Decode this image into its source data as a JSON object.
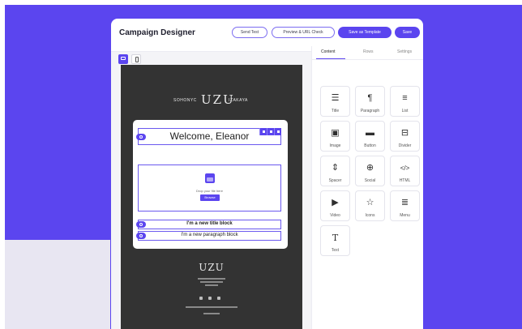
{
  "app": {
    "title": "Campaign Designer"
  },
  "header": {
    "buttons": [
      {
        "label": "Send Test"
      },
      {
        "label": "Preview & URL Check"
      },
      {
        "label": "Save as Template"
      },
      {
        "label": "Save"
      }
    ]
  },
  "device_toggle": {
    "desktop_icon": "desktop-icon",
    "mobile_icon": "mobile-icon",
    "active": "desktop"
  },
  "email": {
    "brand_left": "SOHONYC",
    "brand_logo": "UZU",
    "brand_right": "IZAKAYA",
    "welcome_text": "Welcome, Eleanor",
    "drop_text": "Drop your file here",
    "browse_label": "Browse",
    "new_title_block": "I'm a new title block",
    "new_paragraph_block": "I'm a new paragraph block",
    "footer_logo": "UZU",
    "row_tools": [
      "save-icon",
      "duplicate-icon",
      "delete-icon"
    ]
  },
  "panel": {
    "tabs": [
      {
        "label": "Content"
      },
      {
        "label": "Rows"
      },
      {
        "label": "Settings"
      }
    ],
    "active_tab": "Content",
    "tiles": [
      {
        "label": "Title",
        "icon": "☰"
      },
      {
        "label": "Paragraph",
        "icon": "¶"
      },
      {
        "label": "List",
        "icon": "≡"
      },
      {
        "label": "Image",
        "icon": "▣"
      },
      {
        "label": "Button",
        "icon": "▬"
      },
      {
        "label": "Divider",
        "icon": "⊟"
      },
      {
        "label": "Spacer",
        "icon": "⇕"
      },
      {
        "label": "Social",
        "icon": "⊕"
      },
      {
        "label": "HTML",
        "icon": "</>"
      },
      {
        "label": "Video",
        "icon": "▶"
      },
      {
        "label": "Icons",
        "icon": "☆"
      },
      {
        "label": "Menu",
        "icon": "≣"
      },
      {
        "label": "Text",
        "icon": "T"
      }
    ]
  },
  "colors": {
    "accent": "#5b45ef",
    "email_background": "#333333",
    "page_background": "#5b45ef"
  }
}
